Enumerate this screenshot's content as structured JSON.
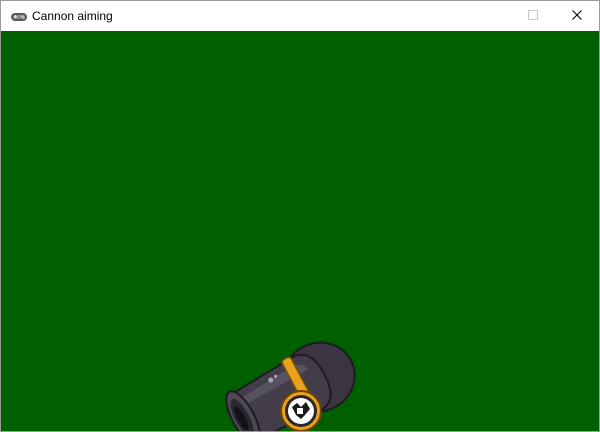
{
  "window": {
    "title": "Cannon aiming",
    "app_icon": "gamepad-icon",
    "buttons": {
      "maximize_icon": "maximize-icon",
      "close_icon": "close-icon"
    }
  },
  "game": {
    "background_color": "#006000",
    "cannon": {
      "icon": "cannon-icon",
      "body_color": "#3b3640",
      "band_color": "#e8a21c"
    }
  }
}
